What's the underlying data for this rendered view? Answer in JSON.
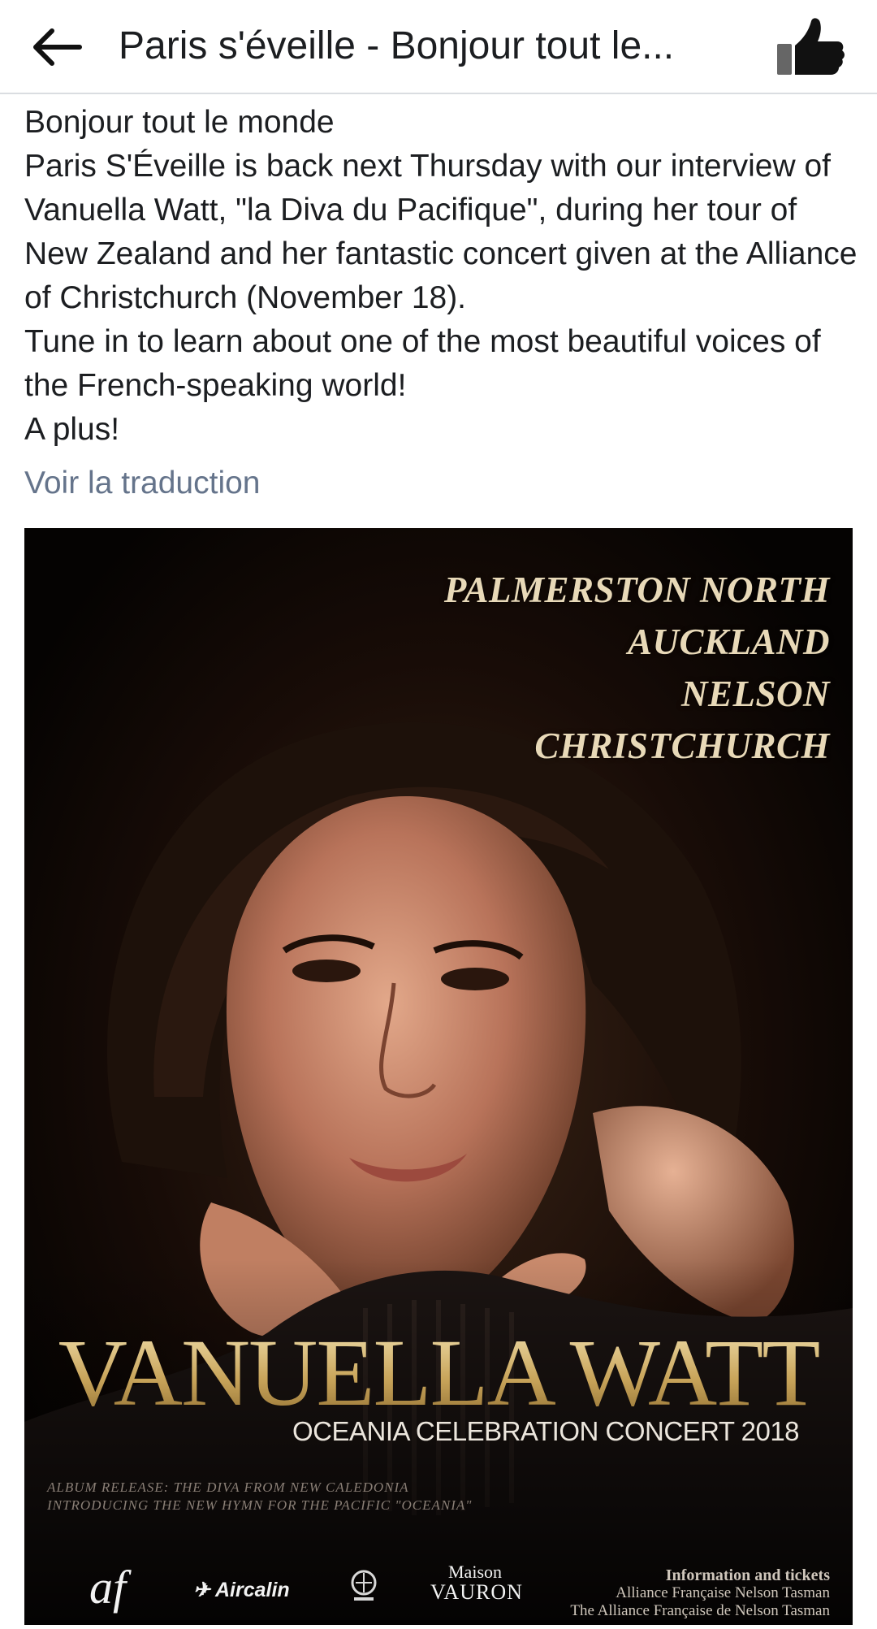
{
  "header": {
    "title": "Paris s'éveille - Bonjour tout le...",
    "back_icon": "arrow-left-icon",
    "like_icon": "thumbs-up-icon"
  },
  "post": {
    "lines": [
      "Bonjour tout le monde",
      "Paris S'Éveille is back next Thursday with our interview of Vanuella Watt, \"la Diva du Pacifique\", during her tour of New Zealand and her fantastic concert given at the Alliance of Christchurch (November 18).",
      "Tune in to learn about one of the most beautiful voices of the French-speaking world!",
      "A plus!"
    ],
    "translate_link": "Voir la traduction"
  },
  "poster": {
    "cities": [
      "PALMERSTON NORTH",
      "AUCKLAND",
      "NELSON",
      "CHRISTCHURCH"
    ],
    "artist_name": "VANUELLA WATT",
    "subtitle": "OCEANIA CELEBRATION CONCERT 2018",
    "album_line1": "ALBUM RELEASE: THE DIVA FROM NEW CALEDONIA",
    "album_line2": "INTRODUCING THE NEW HYMN FOR THE PACIFIC \"OCEANIA\"",
    "logos": {
      "af": "af",
      "aircalin": "Aircalin",
      "vauron_small": "Maison",
      "vauron": "VAURON"
    },
    "info_heading": "Information and tickets",
    "info_line1": "Alliance Française Nelson Tasman",
    "info_line2": "The Alliance Française de Nelson Tasman"
  },
  "colors": {
    "link": "#65748b",
    "text": "#1c1e21",
    "poster_gold": "#d9bd82"
  }
}
